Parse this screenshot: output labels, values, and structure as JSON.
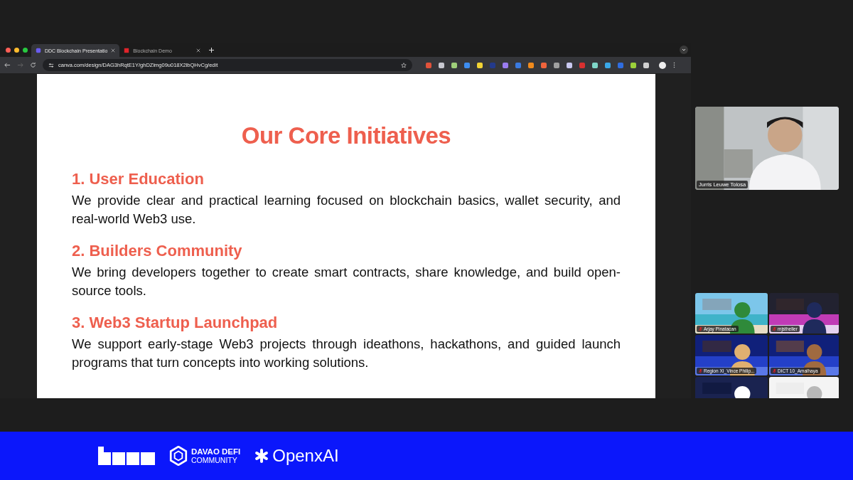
{
  "browser": {
    "tabs": [
      {
        "title": "DDC Blockchain Presentatio",
        "selected": true
      },
      {
        "title": "Blockchain Demo",
        "selected": false
      }
    ],
    "address": "canva.com/design/DAG3hRqtE1Y/ghDZlmg09u018X2lbQHvCg/edit"
  },
  "slide": {
    "title": "Our Core Initiatives",
    "sections": [
      {
        "heading": "1. User Education",
        "body": "We provide clear and practical learning focused on blockchain basics, wallet security, and real-world Web3 use."
      },
      {
        "heading": "2. Builders Community",
        "body": "We bring developers together to create smart contracts, share knowledge, and build open-source tools."
      },
      {
        "heading": "3. Web3 Startup Launchpad",
        "body": "We support early-stage Web3 projects through ideathons, hackathons, and guided launch programs that turn concepts into working solutions."
      }
    ]
  },
  "call": {
    "speaker": {
      "name": "Jurris Leuwe Tolosa"
    },
    "participants": [
      {
        "name": "Arjay Pinatacan",
        "muted": true
      },
      {
        "name": "mjstheller",
        "muted": true
      },
      {
        "name": "Region XI_Vince Philip...",
        "muted": true
      },
      {
        "name": "DICT 10_Amalhaya",
        "muted": true
      },
      {
        "kind": "picture"
      },
      {
        "kind": "picture"
      }
    ]
  },
  "sponsors": [
    {
      "kind": "blocks"
    },
    {
      "kind": "badge",
      "name": "DAVAO DEFI",
      "sub": "COMMUNITY"
    },
    {
      "kind": "flower",
      "name": "OpenxAI"
    }
  ]
}
